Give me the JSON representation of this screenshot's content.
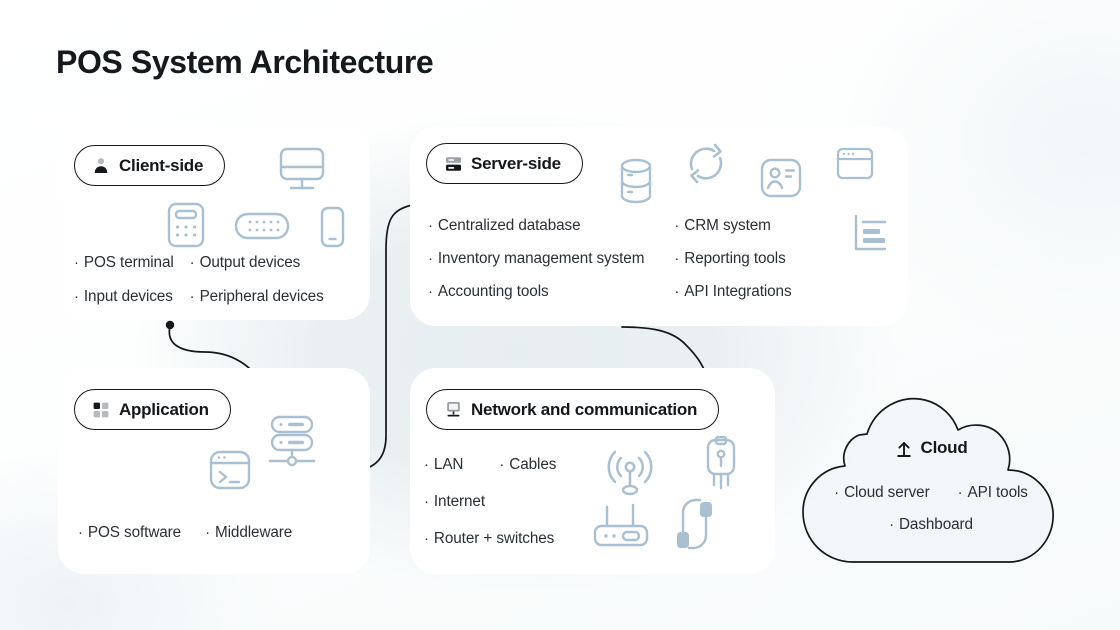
{
  "page": {
    "title": "POS System Architecture"
  },
  "colors": {
    "ink": "#15181b",
    "body_text": "#2a2f34",
    "icon_line": "#a9c0d2",
    "card_bg": "#ffffff",
    "page_bg": "#eaf0f2"
  },
  "cards": {
    "client": {
      "title": "Client-side",
      "icon": "person-icon",
      "items_left": [
        "POS terminal",
        "Input devices"
      ],
      "items_right": [
        "Output devices",
        "Peripheral devices"
      ],
      "decor_icons": [
        "monitor-icon",
        "pos-terminal-icon",
        "keyboard-icon",
        "smartphone-icon"
      ]
    },
    "server": {
      "title": "Server-side",
      "icon": "server-rack-icon",
      "items_left": [
        "Centralized database",
        "Inventory management system",
        "Accounting tools"
      ],
      "items_right": [
        "CRM system",
        "Reporting tools",
        "API Integrations"
      ],
      "decor_icons": [
        "database-icon",
        "sync-icon",
        "contact-card-icon",
        "browser-window-icon",
        "report-chart-icon"
      ]
    },
    "application": {
      "title": "Application",
      "icon": "grid-squares-icon",
      "items": [
        "POS software",
        "Middleware"
      ],
      "decor_icons": [
        "terminal-icon",
        "server-stack-icon"
      ]
    },
    "network": {
      "title": "Network and communication",
      "icon": "desktop-network-icon",
      "items_row1": [
        "LAN",
        "Cables"
      ],
      "items_row2": [
        "Internet"
      ],
      "items_row3": [
        "Router + switches"
      ],
      "decor_icons": [
        "antenna-signal-icon",
        "ethernet-plug-icon",
        "router-icon",
        "power-cable-icon"
      ]
    },
    "cloud": {
      "title": "Cloud",
      "icon": "upload-arrow-icon",
      "items_row1": [
        "Cloud server",
        "API tools"
      ],
      "items_row2": [
        "Dashboard"
      ]
    }
  },
  "connectors": [
    {
      "name": "client-to-application",
      "from": "client",
      "to": "application"
    },
    {
      "name": "application-to-server",
      "from": "application",
      "to": "server"
    },
    {
      "name": "server-to-network",
      "from": "server",
      "to": "network"
    }
  ]
}
